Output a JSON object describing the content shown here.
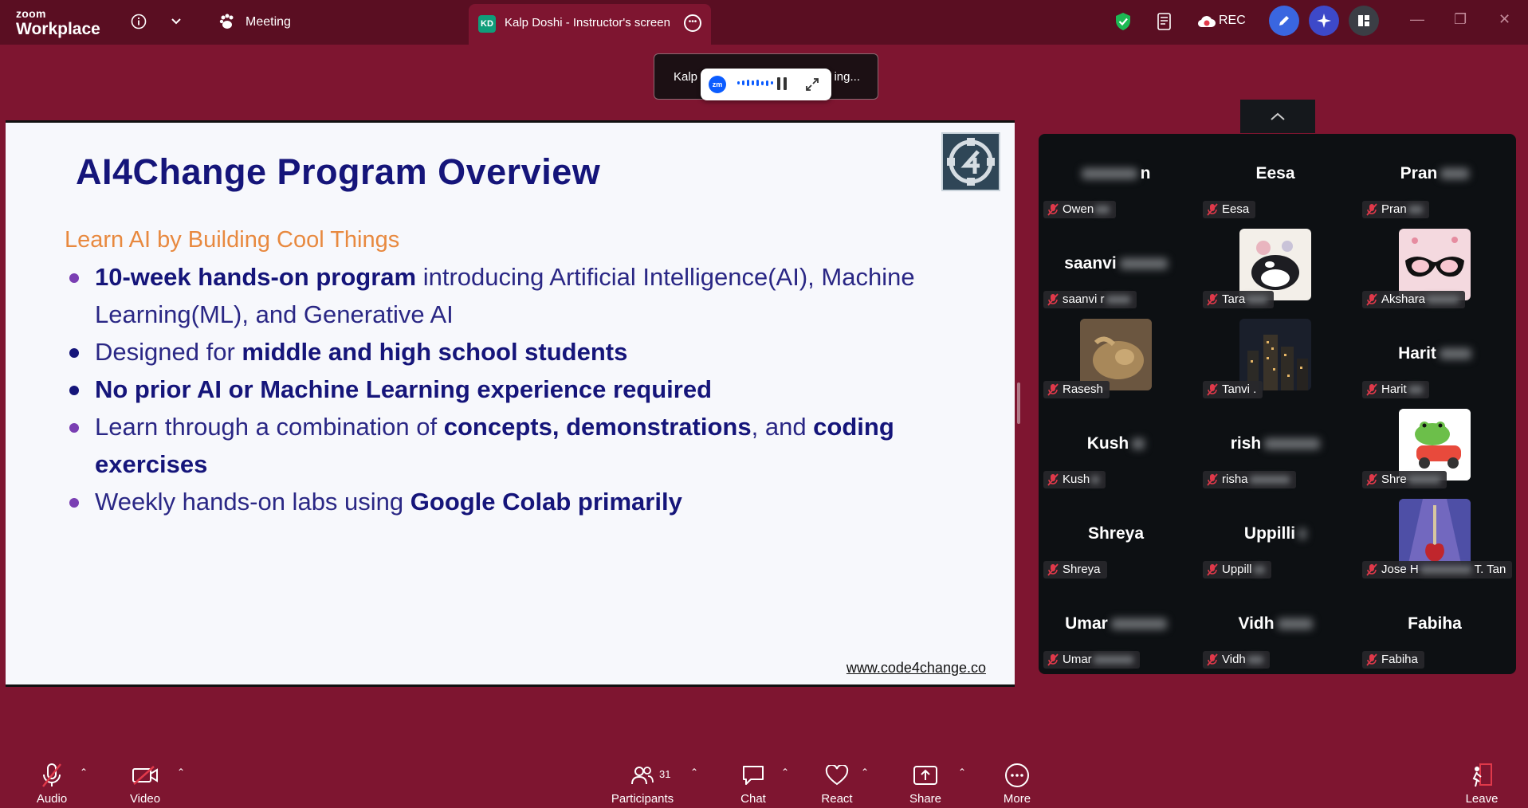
{
  "app": {
    "brand_top": "zoom",
    "brand_bottom": "Workplace"
  },
  "topbar": {
    "meeting_label": "Meeting",
    "share_tab": {
      "initials": "KD",
      "title": "Kalp Doshi - Instructor's screen"
    },
    "rec_label": "REC"
  },
  "speaking_popup": {
    "left_text": "Kalp",
    "right_text": "ing...",
    "mini_logo": "zm"
  },
  "slide": {
    "title": "AI4Change Program Overview",
    "subtitle": "Learn AI by Building Cool Things",
    "bullets": [
      {
        "bold": "10-week hands-on program",
        "rest": " introducing Artificial Intelligence(AI), Machine Learning(ML), and Generative AI"
      },
      {
        "pre": "Designed for ",
        "bold": "middle and high school students"
      },
      {
        "bold": "No prior AI or Machine Learning experience required"
      },
      {
        "pre": "Learn through a combination of ",
        "bold": "concepts, demonstrations",
        "mid": ", and ",
        "bold2": "coding exercises"
      },
      {
        "pre": "Weekly hands-on labs using ",
        "bold": "Google Colab primarily"
      }
    ],
    "url": "www.code4change.co"
  },
  "gallery": {
    "tiles": [
      {
        "big": "",
        "tag": "Owen"
      },
      {
        "big": "Eesa",
        "tag": "Eesa"
      },
      {
        "big": "Pran",
        "tag": "Pran"
      },
      {
        "big": "saanvi",
        "tag": "saanvi r"
      },
      {
        "big": "",
        "tag": "Tara"
      },
      {
        "big": "",
        "tag": "Akshara"
      },
      {
        "big": "",
        "tag": "Rasesh"
      },
      {
        "big": "",
        "tag": "Tanvi ."
      },
      {
        "big": "Harit",
        "tag": "Harit"
      },
      {
        "big": "Kush",
        "tag": "Kush"
      },
      {
        "big": "rish",
        "tag": "risha"
      },
      {
        "big": "",
        "tag": "Shre"
      },
      {
        "big": "Shreya",
        "tag": "Shreya"
      },
      {
        "big": "Uppilli",
        "tag": "Uppill"
      },
      {
        "big": "",
        "tag": "Jose H",
        "tag_suffix": "T. Tan"
      },
      {
        "big": "Umar",
        "tag": "Umar"
      },
      {
        "big": "Vidh",
        "tag": "Vidh"
      },
      {
        "big": "Fabiha",
        "tag": "Fabiha"
      }
    ]
  },
  "toolbar": {
    "audio": "Audio",
    "video": "Video",
    "participants": "Participants",
    "participants_count": "31",
    "chat": "Chat",
    "react": "React",
    "share": "Share",
    "more": "More",
    "leave": "Leave"
  },
  "colors": {
    "background": "#7e1530",
    "topbar": "#5a0e22",
    "slide_title": "#15157a",
    "slide_subtitle": "#e8893f",
    "bullet_purple": "#7a3fb3",
    "muted_red": "#e0394a"
  }
}
